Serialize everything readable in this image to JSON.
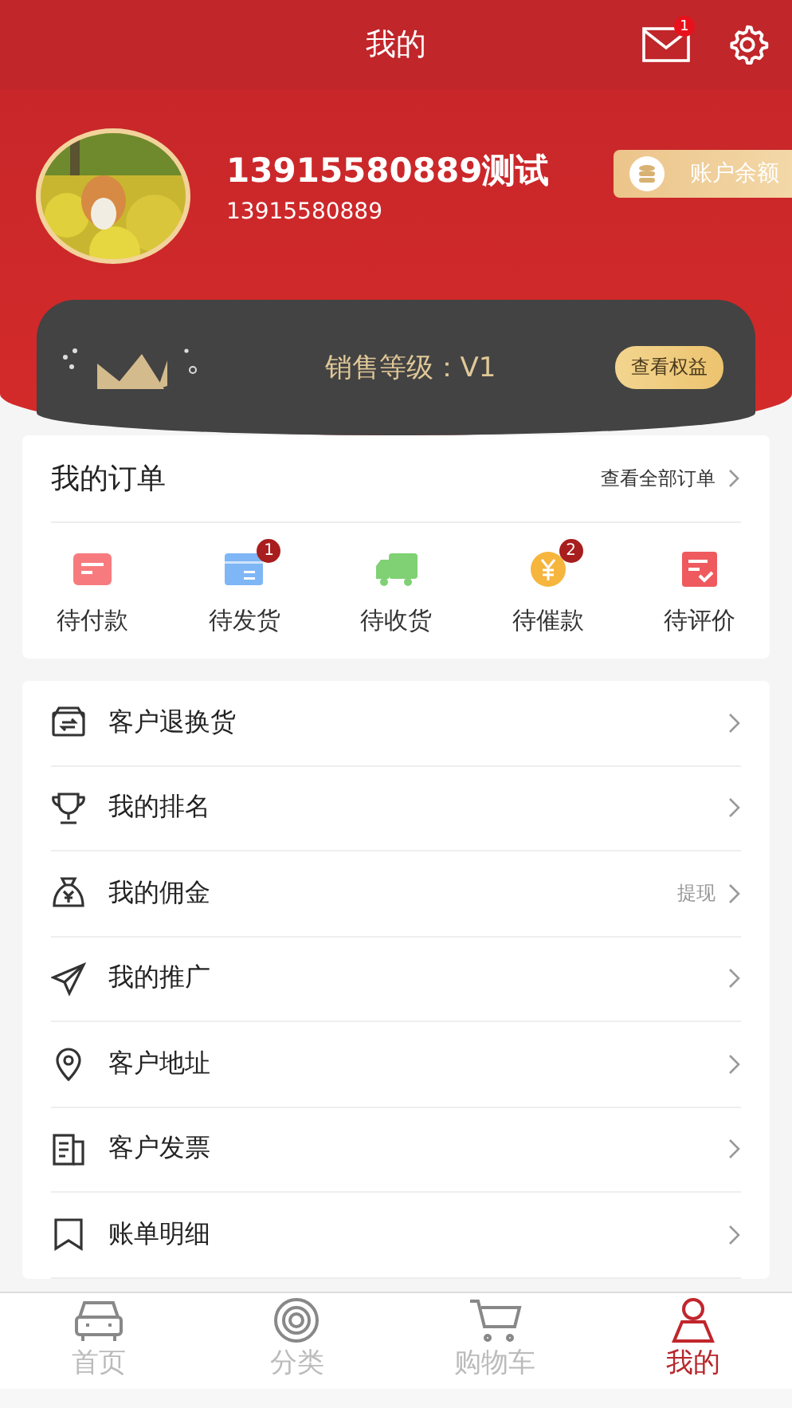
{
  "header": {
    "title": "我的",
    "mail_badge": "1"
  },
  "profile": {
    "name": "13915580889测试",
    "phone": "13915580889",
    "balance_button": "账户余额"
  },
  "level_card": {
    "text": "销售等级：V1",
    "button": "查看权益"
  },
  "orders": {
    "title": "我的订单",
    "view_all": "查看全部订单",
    "items": [
      {
        "kind": "pay",
        "label": "待付款"
      },
      {
        "kind": "ship",
        "label": "待发货",
        "badge": "1"
      },
      {
        "kind": "receive",
        "label": "待收货"
      },
      {
        "kind": "remind",
        "label": "待催款",
        "badge": "2"
      },
      {
        "kind": "review",
        "label": "待评价"
      }
    ]
  },
  "menu": [
    {
      "kind": "return",
      "label": "客户退换货"
    },
    {
      "kind": "rank",
      "label": "我的排名"
    },
    {
      "kind": "commission",
      "label": "我的佣金",
      "extra": "提现"
    },
    {
      "kind": "promo",
      "label": "我的推广"
    },
    {
      "kind": "address",
      "label": "客户地址"
    },
    {
      "kind": "invoice",
      "label": "客户发票"
    },
    {
      "kind": "bill",
      "label": "账单明细"
    }
  ],
  "tabbar": [
    {
      "kind": "home",
      "label": "首页",
      "selected": false
    },
    {
      "kind": "category",
      "label": "分类",
      "selected": false
    },
    {
      "kind": "cart",
      "label": "购物车",
      "selected": false
    },
    {
      "kind": "me",
      "label": "我的",
      "selected": true
    }
  ]
}
